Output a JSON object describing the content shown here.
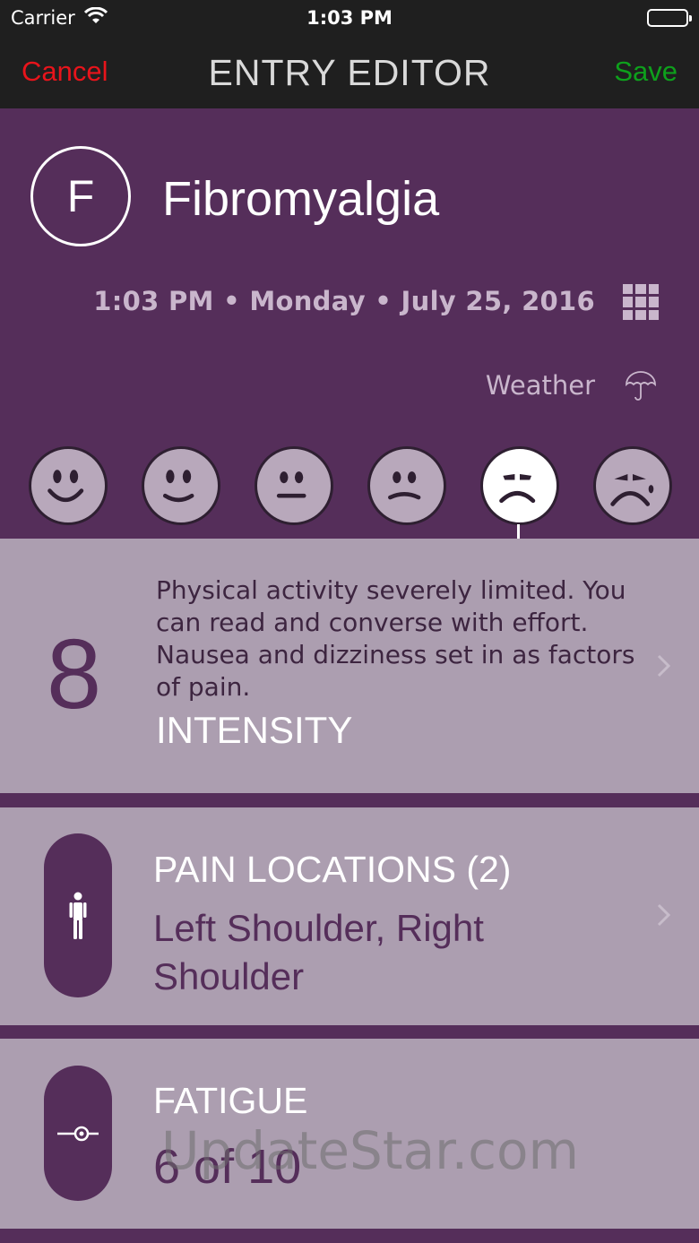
{
  "status_bar": {
    "carrier": "Carrier",
    "time": "1:03 PM"
  },
  "nav": {
    "cancel": "Cancel",
    "title": "ENTRY EDITOR",
    "save": "Save"
  },
  "condition": {
    "initial": "F",
    "name": "Fibromyalgia"
  },
  "entry": {
    "datetime": "1:03 PM • Monday • July 25, 2016"
  },
  "weather": {
    "label": "Weather"
  },
  "faces": {
    "selected_index": 4,
    "items": [
      "face-very-happy",
      "face-happy",
      "face-neutral",
      "face-worried",
      "face-sad",
      "face-very-sad"
    ]
  },
  "intensity": {
    "value": "8",
    "description": "Physical activity severely limited. You can read and converse with effort. Nausea and dizziness set in as factors of pain.",
    "label": "INTENSITY"
  },
  "pain_locations": {
    "label": "PAIN LOCATIONS (2)",
    "value": "Left Shoulder, Right Shoulder"
  },
  "fatigue": {
    "label": "FATIGUE",
    "value": "6 of 10"
  },
  "watermark": "UpdateStar.com",
  "colors": {
    "accent": "#552e5a",
    "card": "#ac9eb0",
    "cancel": "#e8141b",
    "save": "#0ea01c"
  }
}
